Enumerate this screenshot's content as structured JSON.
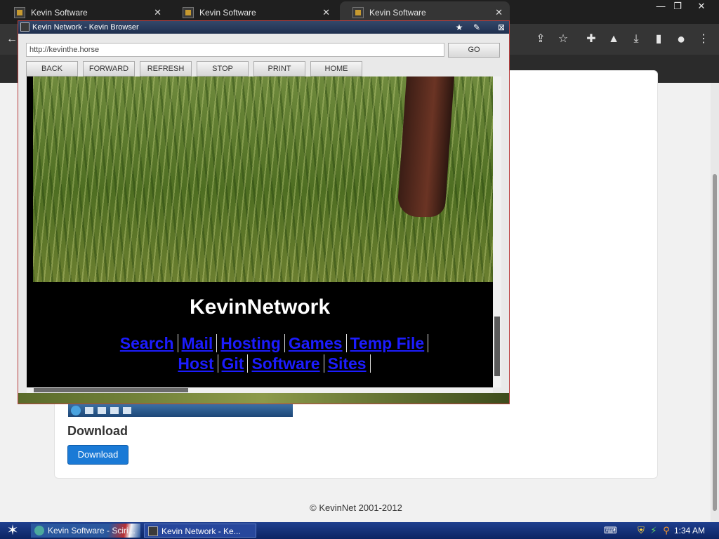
{
  "chrome": {
    "tabs": [
      {
        "label": "Kevin Software",
        "close": "✕"
      },
      {
        "label": "Kevin Software",
        "close": "✕"
      },
      {
        "label": "Kevin Software",
        "close": "✕"
      }
    ],
    "window_controls": {
      "minimize": "—",
      "restore": "❐",
      "close": "✕"
    },
    "toolbar_icons": [
      "back-icon",
      "share-icon",
      "star-icon",
      "extensions-icon",
      "labs-icon",
      "download-icon",
      "sidepanel-icon",
      "profile-icon",
      "menu-icon"
    ],
    "toolbar_glyphs": {
      "back": "←",
      "share": "⇪",
      "star": "☆",
      "extensions": "✚",
      "labs": "▲",
      "download": "⤓",
      "sidepanel": "▮",
      "profile": "●",
      "menu": "⋮"
    }
  },
  "page": {
    "download_heading": "Download",
    "download_button": "Download",
    "footer": "© KevinNet 2001-2012"
  },
  "kevin_browser": {
    "title": "Kevin Network - Kevin Browser",
    "title_buttons": {
      "star": "★",
      "edit": "✎",
      "close": "⊠"
    },
    "address": "http://kevinthe.horse",
    "go": "GO",
    "nav": [
      "BACK",
      "FORWARD",
      "REFRESH",
      "STOP",
      "PRINT",
      "HOME"
    ],
    "site_title": "KevinNetwork",
    "links": [
      "Search",
      "Mail",
      "Hosting",
      "Games",
      "Temp File",
      "Host",
      "Git",
      "Software",
      "Sites"
    ]
  },
  "taskbar": {
    "start_glyph": "✶",
    "tasks": [
      {
        "label": "Kevin Software - Sciri..."
      },
      {
        "label": "Kevin Network - Ke..."
      }
    ],
    "tray_glyphs": {
      "keyboard": "⌨",
      "shield": "⛨",
      "network": "⚡",
      "search": "⚲"
    },
    "clock": "1:34 AM"
  },
  "colors": {
    "link": "#1c1cff",
    "download_button": "#1a7ad6",
    "taskbar": "#0c2463"
  }
}
